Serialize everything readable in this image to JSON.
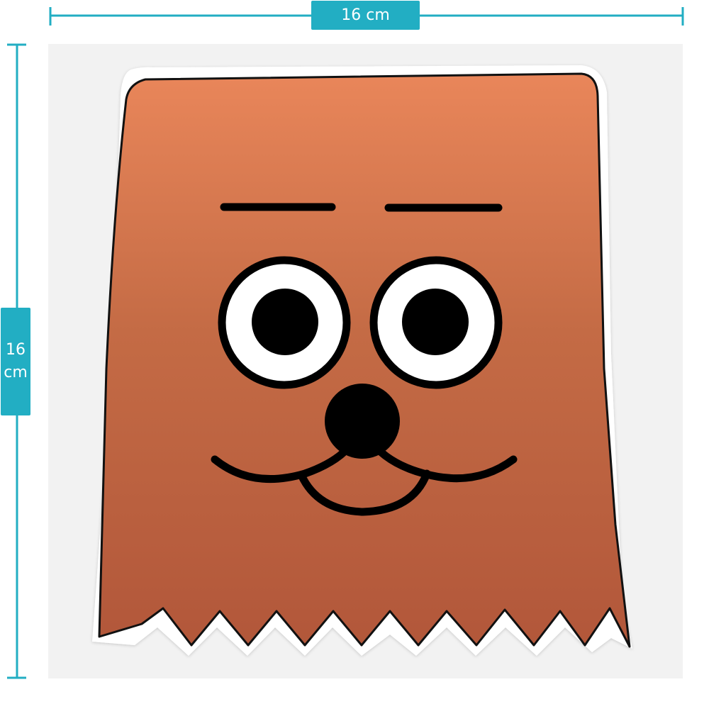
{
  "dimensions": {
    "width_value": "16",
    "width_unit": "cm",
    "height_value": "16",
    "height_unit": "cm"
  },
  "sticker": {
    "subject": "paper bag face",
    "bag_color": "#b9613f",
    "accent_color": "#22aec3"
  }
}
